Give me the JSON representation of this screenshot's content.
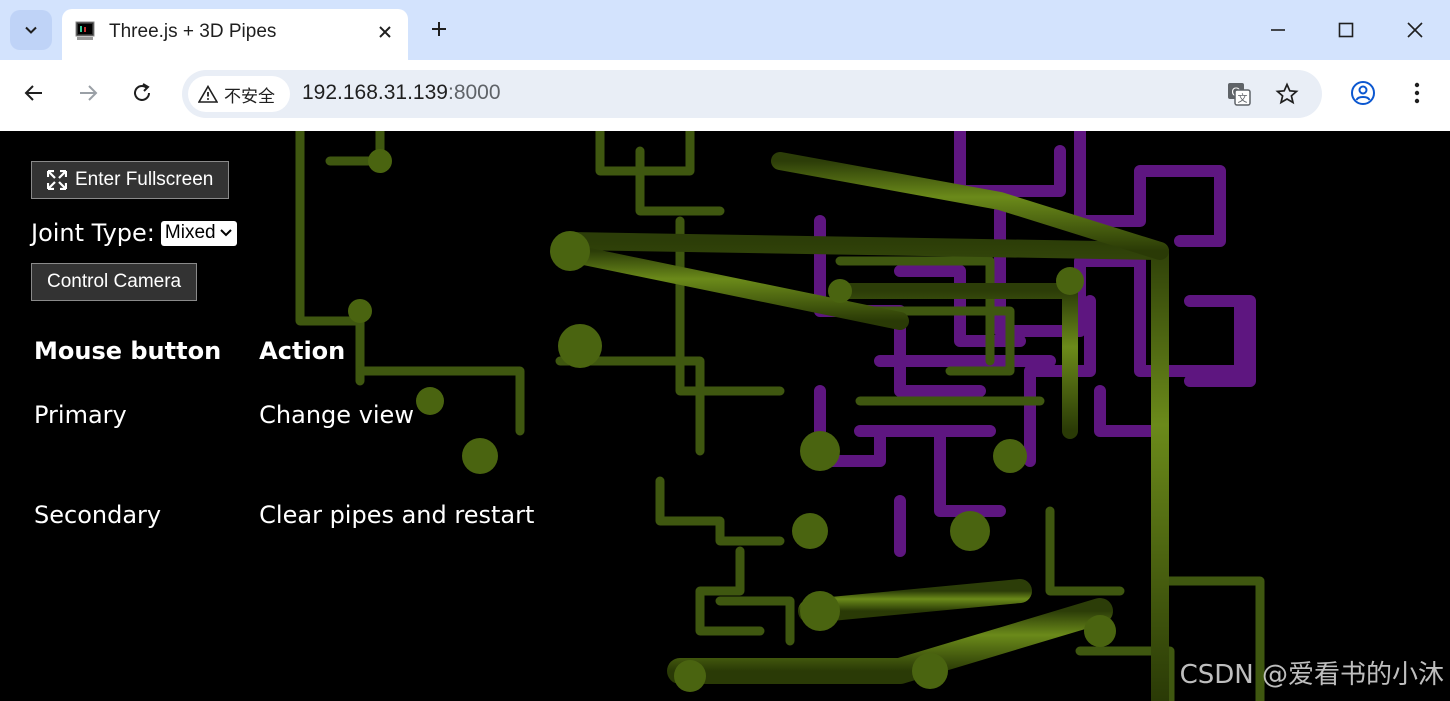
{
  "browser": {
    "tab": {
      "title": "Three.js + 3D Pipes"
    },
    "address": {
      "security_label": "不安全",
      "host": "192.168.31.139",
      "port": ":8000"
    },
    "icons": [
      "tab-search-icon",
      "favicon-icon",
      "close-icon",
      "plus-icon",
      "minimize-icon",
      "maximize-icon",
      "close-window-icon",
      "back-icon",
      "forward-icon",
      "reload-icon",
      "warning-icon",
      "translate-icon",
      "star-icon",
      "profile-icon",
      "menu-icon"
    ]
  },
  "page": {
    "fullscreen_label": "Enter Fullscreen",
    "joint_type_label": "Joint Type:",
    "joint_type_value": "Mixed",
    "camera_label": "Control Camera",
    "help_table": {
      "headers": [
        "Mouse button",
        "Action"
      ],
      "rows": [
        [
          "Primary",
          "Change view"
        ],
        [
          "Secondary",
          "Clear pipes and restart"
        ]
      ]
    }
  },
  "watermark": "CSDN @爱看书的小沐",
  "colors": {
    "pipe_green": "#4a6410",
    "pipe_purple": "#6a1a8a",
    "tabstrip": "#d3e3fd"
  }
}
